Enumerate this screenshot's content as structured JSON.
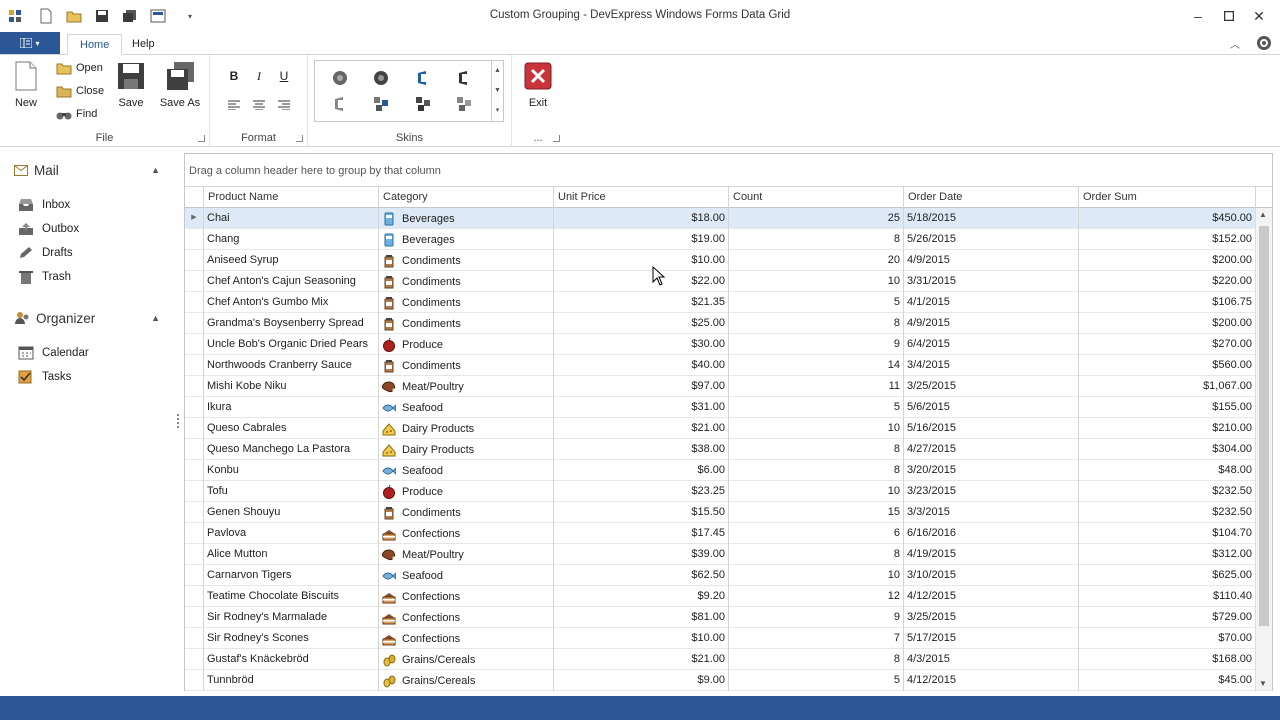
{
  "window": {
    "title": "Custom Grouping - DevExpress Windows Forms Data Grid"
  },
  "tabs": [
    {
      "label": "Home"
    },
    {
      "label": "Help"
    }
  ],
  "ribbon": {
    "file_group": {
      "caption": "File",
      "new": "New",
      "open": "Open",
      "close": "Close",
      "find": "Find",
      "save": "Save",
      "save_as": "Save As"
    },
    "format_group": {
      "caption": "Format",
      "bold": "B",
      "italic": "I",
      "underline": "U"
    },
    "skins_group": {
      "caption": "Skins"
    },
    "exit_group": {
      "caption": "...",
      "exit": "Exit"
    }
  },
  "nav": {
    "mail": {
      "header": "Mail",
      "items": [
        "Inbox",
        "Outbox",
        "Drafts",
        "Trash"
      ]
    },
    "organizer": {
      "header": "Organizer",
      "items": [
        "Calendar",
        "Tasks"
      ]
    }
  },
  "grid": {
    "group_panel_text": "Drag a column header here to group by that column",
    "columns": [
      "Product Name",
      "Category",
      "Unit Price",
      "Count",
      "Order Date",
      "Order Sum"
    ],
    "rows": [
      [
        "Chai",
        "Beverages",
        "$18.00",
        "25",
        "5/18/2015",
        "$450.00"
      ],
      [
        "Chang",
        "Beverages",
        "$19.00",
        "8",
        "5/26/2015",
        "$152.00"
      ],
      [
        "Aniseed Syrup",
        "Condiments",
        "$10.00",
        "20",
        "4/9/2015",
        "$200.00"
      ],
      [
        "Chef Anton's Cajun Seasoning",
        "Condiments",
        "$22.00",
        "10",
        "3/31/2015",
        "$220.00"
      ],
      [
        "Chef Anton's Gumbo Mix",
        "Condiments",
        "$21.35",
        "5",
        "4/1/2015",
        "$106.75"
      ],
      [
        "Grandma's Boysenberry Spread",
        "Condiments",
        "$25.00",
        "8",
        "4/9/2015",
        "$200.00"
      ],
      [
        "Uncle Bob's Organic Dried Pears",
        "Produce",
        "$30.00",
        "9",
        "6/4/2015",
        "$270.00"
      ],
      [
        "Northwoods Cranberry Sauce",
        "Condiments",
        "$40.00",
        "14",
        "3/4/2015",
        "$560.00"
      ],
      [
        "Mishi Kobe Niku",
        "Meat/Poultry",
        "$97.00",
        "11",
        "3/25/2015",
        "$1,067.00"
      ],
      [
        "Ikura",
        "Seafood",
        "$31.00",
        "5",
        "5/6/2015",
        "$155.00"
      ],
      [
        "Queso Cabrales",
        "Dairy Products",
        "$21.00",
        "10",
        "5/16/2015",
        "$210.00"
      ],
      [
        "Queso Manchego La Pastora",
        "Dairy Products",
        "$38.00",
        "8",
        "4/27/2015",
        "$304.00"
      ],
      [
        "Konbu",
        "Seafood",
        "$6.00",
        "8",
        "3/20/2015",
        "$48.00"
      ],
      [
        "Tofu",
        "Produce",
        "$23.25",
        "10",
        "3/23/2015",
        "$232.50"
      ],
      [
        "Genen Shouyu",
        "Condiments",
        "$15.50",
        "15",
        "3/3/2015",
        "$232.50"
      ],
      [
        "Pavlova",
        "Confections",
        "$17.45",
        "6",
        "6/16/2016",
        "$104.70"
      ],
      [
        "Alice Mutton",
        "Meat/Poultry",
        "$39.00",
        "8",
        "4/19/2015",
        "$312.00"
      ],
      [
        "Carnarvon Tigers",
        "Seafood",
        "$62.50",
        "10",
        "3/10/2015",
        "$625.00"
      ],
      [
        "Teatime Chocolate Biscuits",
        "Confections",
        "$9.20",
        "12",
        "4/12/2015",
        "$110.40"
      ],
      [
        "Sir Rodney's Marmalade",
        "Confections",
        "$81.00",
        "9",
        "3/25/2015",
        "$729.00"
      ],
      [
        "Sir Rodney's Scones",
        "Confections",
        "$10.00",
        "7",
        "5/17/2015",
        "$70.00"
      ],
      [
        "Gustaf's Knäckebröd",
        "Grains/Cereals",
        "$21.00",
        "8",
        "4/3/2015",
        "$168.00"
      ],
      [
        "Tunnbröd",
        "Grains/Cereals",
        "$9.00",
        "5",
        "4/12/2015",
        "$45.00"
      ]
    ]
  },
  "colors": {
    "accent": "#2b5797",
    "selected_row": "#dde9f6",
    "exit_red": "#c8343a"
  }
}
